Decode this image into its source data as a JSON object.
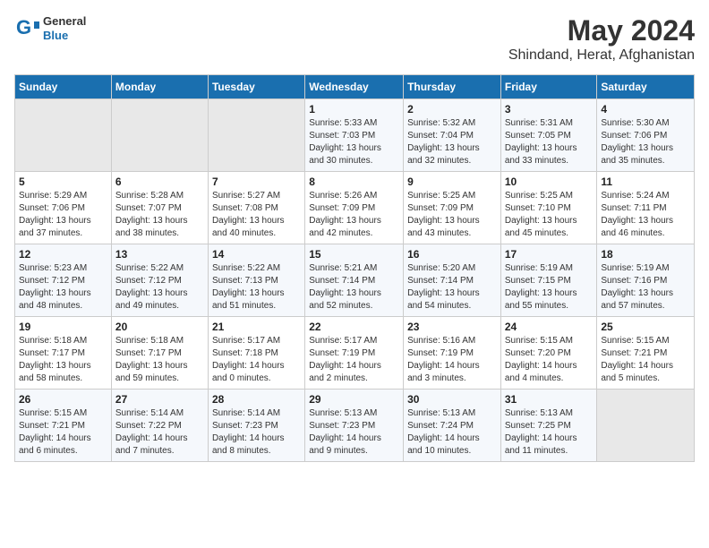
{
  "header": {
    "logo_general": "General",
    "logo_blue": "Blue",
    "month_title": "May 2024",
    "location": "Shindand, Herat, Afghanistan"
  },
  "days_of_week": [
    "Sunday",
    "Monday",
    "Tuesday",
    "Wednesday",
    "Thursday",
    "Friday",
    "Saturday"
  ],
  "weeks": [
    [
      {
        "day": "",
        "info": ""
      },
      {
        "day": "",
        "info": ""
      },
      {
        "day": "",
        "info": ""
      },
      {
        "day": "1",
        "info": "Sunrise: 5:33 AM\nSunset: 7:03 PM\nDaylight: 13 hours\nand 30 minutes."
      },
      {
        "day": "2",
        "info": "Sunrise: 5:32 AM\nSunset: 7:04 PM\nDaylight: 13 hours\nand 32 minutes."
      },
      {
        "day": "3",
        "info": "Sunrise: 5:31 AM\nSunset: 7:05 PM\nDaylight: 13 hours\nand 33 minutes."
      },
      {
        "day": "4",
        "info": "Sunrise: 5:30 AM\nSunset: 7:06 PM\nDaylight: 13 hours\nand 35 minutes."
      }
    ],
    [
      {
        "day": "5",
        "info": "Sunrise: 5:29 AM\nSunset: 7:06 PM\nDaylight: 13 hours\nand 37 minutes."
      },
      {
        "day": "6",
        "info": "Sunrise: 5:28 AM\nSunset: 7:07 PM\nDaylight: 13 hours\nand 38 minutes."
      },
      {
        "day": "7",
        "info": "Sunrise: 5:27 AM\nSunset: 7:08 PM\nDaylight: 13 hours\nand 40 minutes."
      },
      {
        "day": "8",
        "info": "Sunrise: 5:26 AM\nSunset: 7:09 PM\nDaylight: 13 hours\nand 42 minutes."
      },
      {
        "day": "9",
        "info": "Sunrise: 5:25 AM\nSunset: 7:09 PM\nDaylight: 13 hours\nand 43 minutes."
      },
      {
        "day": "10",
        "info": "Sunrise: 5:25 AM\nSunset: 7:10 PM\nDaylight: 13 hours\nand 45 minutes."
      },
      {
        "day": "11",
        "info": "Sunrise: 5:24 AM\nSunset: 7:11 PM\nDaylight: 13 hours\nand 46 minutes."
      }
    ],
    [
      {
        "day": "12",
        "info": "Sunrise: 5:23 AM\nSunset: 7:12 PM\nDaylight: 13 hours\nand 48 minutes."
      },
      {
        "day": "13",
        "info": "Sunrise: 5:22 AM\nSunset: 7:12 PM\nDaylight: 13 hours\nand 49 minutes."
      },
      {
        "day": "14",
        "info": "Sunrise: 5:22 AM\nSunset: 7:13 PM\nDaylight: 13 hours\nand 51 minutes."
      },
      {
        "day": "15",
        "info": "Sunrise: 5:21 AM\nSunset: 7:14 PM\nDaylight: 13 hours\nand 52 minutes."
      },
      {
        "day": "16",
        "info": "Sunrise: 5:20 AM\nSunset: 7:14 PM\nDaylight: 13 hours\nand 54 minutes."
      },
      {
        "day": "17",
        "info": "Sunrise: 5:19 AM\nSunset: 7:15 PM\nDaylight: 13 hours\nand 55 minutes."
      },
      {
        "day": "18",
        "info": "Sunrise: 5:19 AM\nSunset: 7:16 PM\nDaylight: 13 hours\nand 57 minutes."
      }
    ],
    [
      {
        "day": "19",
        "info": "Sunrise: 5:18 AM\nSunset: 7:17 PM\nDaylight: 13 hours\nand 58 minutes."
      },
      {
        "day": "20",
        "info": "Sunrise: 5:18 AM\nSunset: 7:17 PM\nDaylight: 13 hours\nand 59 minutes."
      },
      {
        "day": "21",
        "info": "Sunrise: 5:17 AM\nSunset: 7:18 PM\nDaylight: 14 hours\nand 0 minutes."
      },
      {
        "day": "22",
        "info": "Sunrise: 5:17 AM\nSunset: 7:19 PM\nDaylight: 14 hours\nand 2 minutes."
      },
      {
        "day": "23",
        "info": "Sunrise: 5:16 AM\nSunset: 7:19 PM\nDaylight: 14 hours\nand 3 minutes."
      },
      {
        "day": "24",
        "info": "Sunrise: 5:15 AM\nSunset: 7:20 PM\nDaylight: 14 hours\nand 4 minutes."
      },
      {
        "day": "25",
        "info": "Sunrise: 5:15 AM\nSunset: 7:21 PM\nDaylight: 14 hours\nand 5 minutes."
      }
    ],
    [
      {
        "day": "26",
        "info": "Sunrise: 5:15 AM\nSunset: 7:21 PM\nDaylight: 14 hours\nand 6 minutes."
      },
      {
        "day": "27",
        "info": "Sunrise: 5:14 AM\nSunset: 7:22 PM\nDaylight: 14 hours\nand 7 minutes."
      },
      {
        "day": "28",
        "info": "Sunrise: 5:14 AM\nSunset: 7:23 PM\nDaylight: 14 hours\nand 8 minutes."
      },
      {
        "day": "29",
        "info": "Sunrise: 5:13 AM\nSunset: 7:23 PM\nDaylight: 14 hours\nand 9 minutes."
      },
      {
        "day": "30",
        "info": "Sunrise: 5:13 AM\nSunset: 7:24 PM\nDaylight: 14 hours\nand 10 minutes."
      },
      {
        "day": "31",
        "info": "Sunrise: 5:13 AM\nSunset: 7:25 PM\nDaylight: 14 hours\nand 11 minutes."
      },
      {
        "day": "",
        "info": ""
      }
    ]
  ]
}
